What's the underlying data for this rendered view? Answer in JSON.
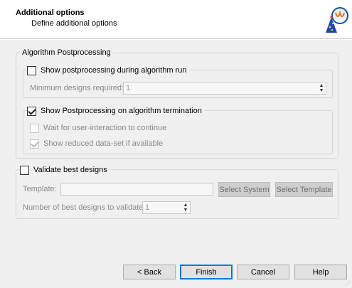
{
  "header": {
    "title": "Additional options",
    "subtitle": "Define additional options"
  },
  "postprocessing": {
    "group_label": "Algorithm Postprocessing",
    "during_run": {
      "label": "Show postprocessing during algorithm run",
      "checked": false,
      "min_designs_label": "Minimum designs required:",
      "min_designs_value": "1"
    },
    "on_termination": {
      "label": "Show Postprocessing on algorithm termination",
      "checked": true,
      "wait_label": "Wait for user-interaction to continue",
      "wait_checked": false,
      "reduced_label": "Show reduced data-set if available",
      "reduced_checked": true
    }
  },
  "validate": {
    "label": "Validate best designs",
    "checked": false,
    "template_label": "Template:",
    "template_value": "",
    "select_system_label": "Select System",
    "select_template_label": "Select Template",
    "num_label": "Number of best designs to validate:",
    "num_value": "1"
  },
  "footer": {
    "back_label": "< Back",
    "finish_label": "Finish",
    "cancel_label": "Cancel",
    "help_label": "Help"
  },
  "colors": {
    "accent": "#0078d7",
    "panel": "#f0f0f0"
  }
}
